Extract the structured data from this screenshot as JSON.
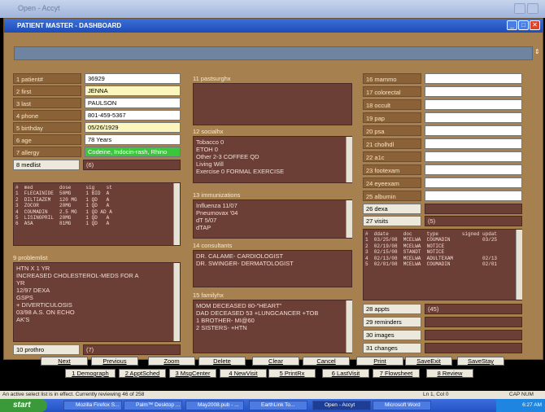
{
  "window": {
    "title": "Open - Accyt"
  },
  "form": {
    "title": "PATIENT MASTER - DASHBOARD"
  },
  "demographics": [
    {
      "label": "1 patient#",
      "value": "36929",
      "style": "white"
    },
    {
      "label": "2 first",
      "value": "JENNA",
      "style": "yel"
    },
    {
      "label": "3 last",
      "value": "PAULSON",
      "style": "white"
    },
    {
      "label": "4 phone",
      "value": "801-459-5367",
      "style": "white"
    },
    {
      "label": "5 birthday",
      "value": "05/26/1929",
      "style": "yel"
    },
    {
      "label": "6 age",
      "value": "78 Years",
      "style": "white"
    },
    {
      "label": "7 allergy",
      "value": "Codeine, Indocin-rash, Rhino",
      "style": "grn"
    }
  ],
  "medlist": {
    "button": "8 medlist",
    "count": "(6)",
    "header": "#  med         dose     sig    st",
    "rows": [
      "1  FLECAINIDE  50MG     1 BID  A",
      "2  DILTIAZEM   120 MG   1 QD   A",
      "3  ZOCOR       20MG     1 QD   A",
      "4  COUMADIN    2.5 MG   1 QD AD A",
      "5  LISINOPRIL  20MG     1 QD   A",
      "6  ASA         81MG     1 QD   A"
    ]
  },
  "problemlist": {
    "heading": "9 problemlist",
    "lines": [
      "HTN X 1 YR",
      "INCREASED CHOLESTEROL-MEDS FOR A",
      "YR",
      "12/97 DEXA",
      "GSPS",
      "+ DIVERTICULOSIS",
      "03/98 A.S. ON ECHO",
      "AK'S"
    ]
  },
  "prothro": {
    "button": "10 prothro",
    "count": "(7)"
  },
  "pastsurghx": {
    "heading": "11 pastsurghx"
  },
  "socialhx": {
    "heading": "12 socialhx",
    "lines": [
      "Tobacco 0",
      "ETOH 0",
      "Other 2-3 COFFEE QD",
      "Living Will",
      "Exercise 0 FORMAL EXERCISE"
    ]
  },
  "immunizations": {
    "heading": "13 immunizations",
    "lines": [
      "Influenza 11/07",
      "Pneumovax '04",
      "dT 5/07",
      "dTAP"
    ]
  },
  "consultants": {
    "heading": "14 consultants",
    "lines": [
      "DR. CALAME- CARDIOLOGIST",
      "DR. SWINGER- DERMATOLOGIST"
    ]
  },
  "familyhx": {
    "heading": "15 familyhx",
    "lines": [
      "MOM DECEASED 80-\"HEART\"",
      "DAD DECEASED 53 +LUNGCANCER +TOB",
      "1 BROTHER- MI@60",
      "2 SISTERS- +HTN"
    ]
  },
  "screening": [
    "16 mammo",
    "17 colorectal",
    "18 occult",
    "19 pap",
    "20 psa",
    "21 cholhdl",
    "22 a1c",
    "23 footexam",
    "24 eyeexam",
    "25 albumin"
  ],
  "dexa": {
    "button": "26 dexa"
  },
  "visits": {
    "button": "27 visits",
    "count": "(5)",
    "header": "#  ddate     doc     type        signed updat",
    "rows": [
      "1  03/25/08  MCELWA  COUMADIN           03/25",
      "2  02/19/08  MCELWA  NOTICE",
      "3  02/15/08  STANDT  NOTICE",
      "4  02/13/08  MCELWA  ADULTEXAM          02/13",
      "5  02/01/08  MCELWA  COUMADIN           02/01"
    ]
  },
  "lower_right": [
    {
      "label": "28 appts",
      "count": "(45)"
    },
    {
      "label": "29 reminders",
      "count": ""
    },
    {
      "label": "30 images",
      "count": ""
    },
    {
      "label": "31 changes",
      "count": ""
    }
  ],
  "nav_buttons": [
    "Next",
    "Previous",
    "Zoom",
    "Delete",
    "Clear",
    "Cancel",
    "Print",
    "SaveExit",
    "SaveStay"
  ],
  "module_buttons": [
    "1 Demograph",
    "2 ApptSched",
    "3 MsgCenter",
    "4 NewVisit",
    "5 PrintRx",
    "6 LastVisit",
    "7 Flowsheet",
    "8 Review"
  ],
  "status": {
    "message": "An active select list is in effect.  Currently reviewing 46 of 258",
    "position": "Ln 1, Col 0",
    "keys": "CAP  NUM"
  },
  "taskbar": {
    "start": "start",
    "items": [
      "Mozilla Firefox S...",
      "Palm™ Desktop ...",
      "May2008.pub - ...",
      "EarthLink To...",
      "Open - Accyt",
      "Microsoft Word"
    ],
    "time": "6:27 AM"
  }
}
